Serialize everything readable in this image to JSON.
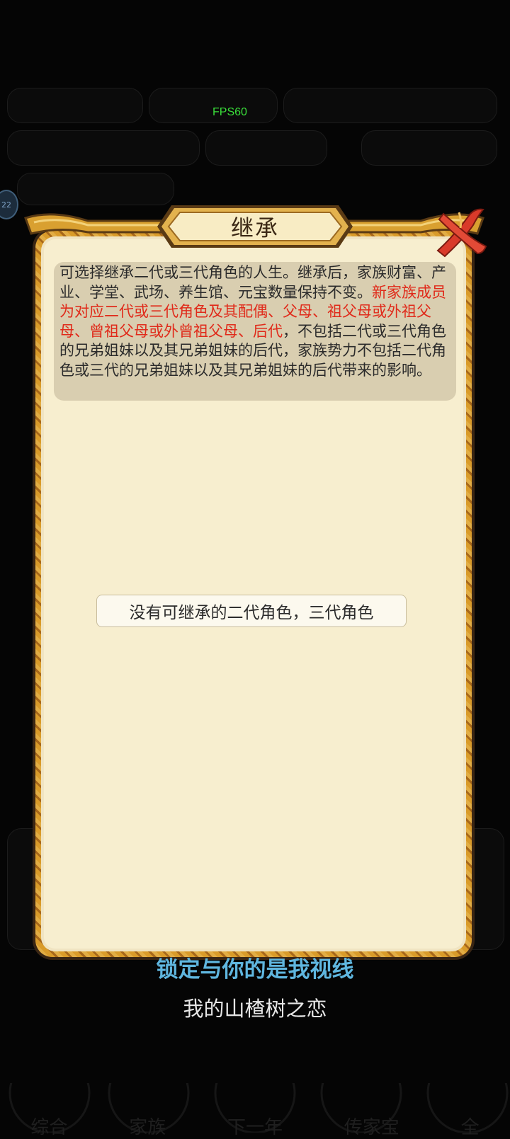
{
  "fps": "FPS60",
  "side_badge": "22",
  "background_ui": {
    "top_row": [
      "",
      "",
      "",
      ""
    ],
    "bottom_nav": [
      "综合",
      "家族",
      "下一年",
      "传家宝",
      "全"
    ]
  },
  "dialog": {
    "title": "继承",
    "description_intro": "可选择继承二代或三代角色的人生。继承后，家族财富、产业、学堂、武场、养生馆、元宝数量保持不变。",
    "description_red": "新家族成员为对应二代或三代角色及其配偶、父母、祖父母或外祖父母、曾祖父母或外曾祖父母、后代",
    "description_rest": "，不包括二代或三代角色的兄弟姐妹以及其兄弟姐妹的后代，家族势力不包括二代角色或三代的兄弟姐妹以及其兄弟姐妹的后代带来的影响。",
    "empty_notice": "没有可继承的二代角色，三代角色",
    "close_icon": "close-x-icon"
  },
  "lyrics": {
    "line1": "锁定与你的是我视线",
    "line2": "我的山楂树之恋"
  },
  "colors": {
    "panel": "#f7eecf",
    "frame_gold": "#d99b2a",
    "highlight_red": "#e02a1a",
    "lyric_blue": "#5fb6df"
  }
}
